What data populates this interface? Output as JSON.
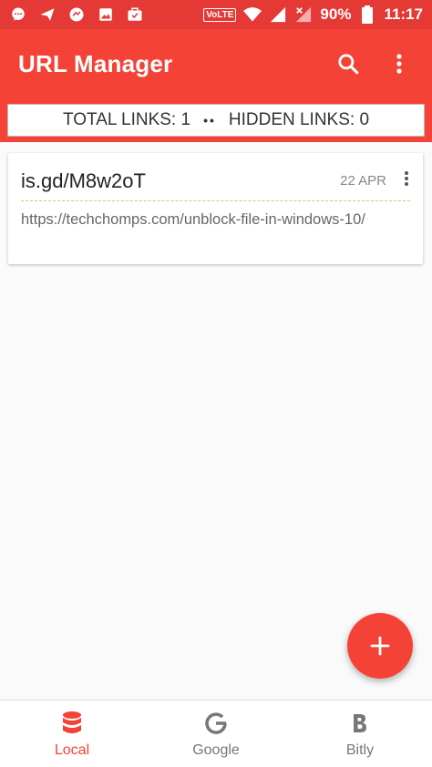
{
  "status_bar": {
    "volte": "VoLTE",
    "battery": "90%",
    "time": "11:17"
  },
  "app_bar": {
    "title": "URL Manager",
    "search_icon": "search-icon",
    "more_icon": "more-vert-icon"
  },
  "stats": {
    "total_links": "TOTAL LINKS: 1",
    "separator": "••",
    "hidden_links": "HIDDEN LINKS: 0"
  },
  "links": [
    {
      "short_url": "is.gd/M8w2oT",
      "date": "22 APR",
      "long_url": "https://techchomps.com/unblock-file-in-windows-10/"
    }
  ],
  "fab": {
    "icon": "plus-icon"
  },
  "bottom_nav": [
    {
      "label": "Local",
      "icon": "database-icon",
      "active": true
    },
    {
      "label": "Google",
      "icon": "google-icon",
      "active": false
    },
    {
      "label": "Bitly",
      "icon": "bitly-icon",
      "active": false
    }
  ],
  "colors": {
    "primary": "#f44336",
    "status_bar": "#e53935",
    "background": "#fafafa",
    "inactive_icon": "#777777"
  }
}
